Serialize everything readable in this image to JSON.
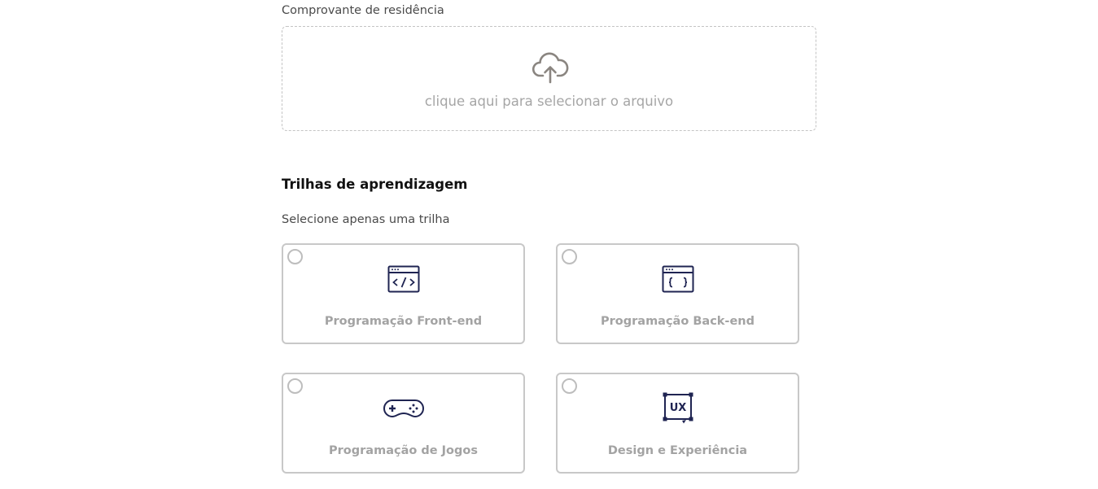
{
  "document_upload": {
    "label": "Comprovante de residência",
    "placeholder": "clique aqui para selecionar o arquivo",
    "icon": "cloud-upload-icon"
  },
  "learning_tracks": {
    "title": "Trilhas de aprendizagem",
    "subtitle": "Selecione apenas uma trilha",
    "options": [
      {
        "label": "Programação Front-end",
        "icon": "code-window-icon",
        "selected": false
      },
      {
        "label": "Programação Back-end",
        "icon": "braces-window-icon",
        "selected": false
      },
      {
        "label": "Programação de Jogos",
        "icon": "gamepad-icon",
        "selected": false
      },
      {
        "label": "Design e Experiência",
        "icon": "ux-icon",
        "selected": false
      }
    ]
  },
  "colors": {
    "icon_navy": "#1f2452",
    "muted_text": "#a3a3a3",
    "border": "#c8c8c8"
  }
}
